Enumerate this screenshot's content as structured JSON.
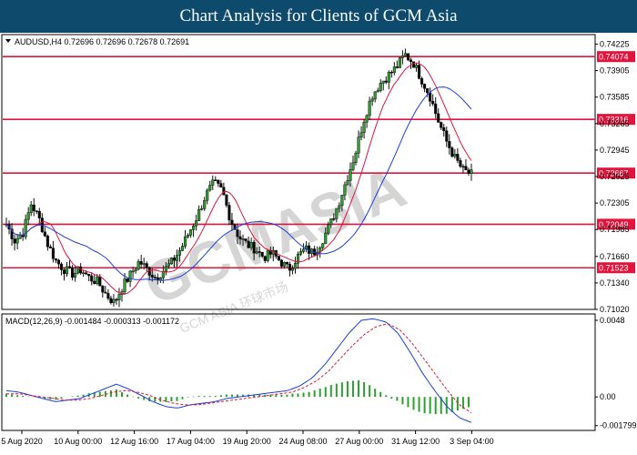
{
  "header": {
    "title": "Chart Analysis for Clients of GCM Asia"
  },
  "colors": {
    "header_bg": "#0d4a6b",
    "level_line": "#e0143c",
    "ma_fast": "#e0143c",
    "ma_slow": "#1a3ee0",
    "macd_line": "#1a3ee0",
    "signal_line": "#e0143c",
    "histogram": "#2ca02c",
    "candle": "#111111",
    "up_candle_body": "#2ca02c",
    "down_candle_body": "#000000"
  },
  "watermark": {
    "text": "GCMASIA",
    "subtext": "GCM ASIA 环球市场"
  },
  "chart_data": [
    {
      "type": "candlestick",
      "symbol_info": "AUDUSD,H4  0.72696 0.72696 0.72678 0.72691",
      "ylim": [
        0.7102,
        0.7434
      ],
      "y_ticks": [
        "0.74225",
        "0.73905",
        "0.73585",
        "0.73265",
        "0.72945",
        "0.72625",
        "0.72305",
        "0.71985",
        "0.71660",
        "0.71340",
        "0.71020"
      ],
      "x_tick_labels": [
        "5 Aug 2020",
        "10 Aug 00:00",
        "12 Aug 16:00",
        "17 Aug 04:00",
        "19 Aug 20:00",
        "24 Aug 08:00",
        "27 Aug 00:00",
        "31 Aug 12:00",
        "3 Sep 04:00"
      ],
      "levels": [
        {
          "label": "0.74074",
          "value": 0.74074
        },
        {
          "label": "0.73316",
          "value": 0.73316
        },
        {
          "label": "0.72667",
          "value": 0.72667
        },
        {
          "label": "0.72049",
          "value": 0.72049
        },
        {
          "label": "0.71523",
          "value": 0.71523
        }
      ],
      "close_path": [
        0.7205,
        0.7185,
        0.7195,
        0.723,
        0.721,
        0.718,
        0.716,
        0.715,
        0.7145,
        0.715,
        0.714,
        0.7135,
        0.712,
        0.711,
        0.713,
        0.7145,
        0.716,
        0.715,
        0.714,
        0.715,
        0.716,
        0.7175,
        0.7195,
        0.7215,
        0.724,
        0.7255,
        0.7245,
        0.721,
        0.719,
        0.718,
        0.7175,
        0.7165,
        0.717,
        0.716,
        0.715,
        0.7165,
        0.7175,
        0.717,
        0.7185,
        0.7205,
        0.723,
        0.726,
        0.729,
        0.733,
        0.736,
        0.7375,
        0.7385,
        0.7395,
        0.741,
        0.74,
        0.738,
        0.736,
        0.733,
        0.7305,
        0.7285,
        0.727,
        0.7265
      ]
    },
    {
      "type": "line",
      "title": "MACD(12,26,9) -0.001484 -0.000313 -0.001172",
      "ylim": [
        -0.0021,
        0.0052
      ],
      "y_ticks": [
        "0.0048",
        "0.00",
        "-0.001799"
      ],
      "macd_path": [
        0.0004,
        0.0003,
        0.0001,
        -0.0001,
        -0.0003,
        -0.0002,
        -0.0001,
        0.0002,
        0.0005,
        0.0008,
        0.0005,
        0.0001,
        -0.0003,
        -0.0006,
        -0.0007,
        -0.0005,
        -0.0004,
        -0.0003,
        -0.0001,
        0.0,
        0.0001,
        0.0002,
        0.0003,
        0.0004,
        0.0007,
        0.0012,
        0.002,
        0.003,
        0.004,
        0.0048,
        0.0049,
        0.0047,
        0.004,
        0.0028,
        0.0015,
        0.0004,
        -0.0006,
        -0.0013,
        -0.0016
      ],
      "signal_path": [
        0.0002,
        0.0002,
        0.0001,
        0.0,
        -0.0001,
        -0.0002,
        -0.0002,
        -0.0001,
        0.0001,
        0.0003,
        0.0004,
        0.0003,
        0.0001,
        -0.0002,
        -0.0004,
        -0.0005,
        -0.0005,
        -0.0004,
        -0.0003,
        -0.0002,
        -0.0001,
        0.0,
        0.0001,
        0.0002,
        0.0003,
        0.0006,
        0.001,
        0.0016,
        0.0024,
        0.0032,
        0.0039,
        0.0044,
        0.0046,
        0.0042,
        0.0034,
        0.0024,
        0.0014,
        0.0004,
        -0.0005,
        -0.001
      ]
    }
  ]
}
